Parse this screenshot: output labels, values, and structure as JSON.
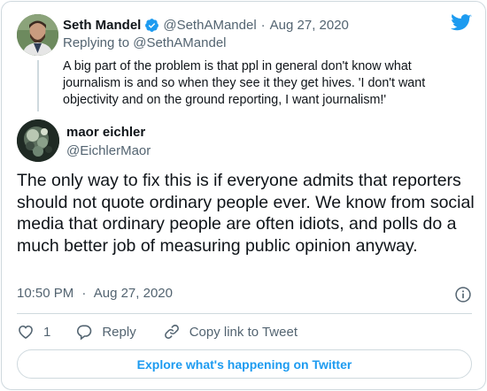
{
  "parent_tweet": {
    "name": "Seth Mandel",
    "handle": "@SethAMandel",
    "separator": "·",
    "date": "Aug 27, 2020",
    "replying_prefix": "Replying to",
    "replying_handle": "@SethAMandel",
    "text": "A big part of the problem is that ppl in general don't know what journalism is and so when they see it they get hives. 'I don't want objectivity and on the ground reporting, I want journalism!'"
  },
  "main_tweet": {
    "name": "maor eichler",
    "handle": "@EichlerMaor",
    "text": "The only way to fix this is if everyone admits that reporters should not quote ordinary people ever. We know from social media that ordinary people are often idiots, and polls do a much better job of measuring public opinion anyway.",
    "time": "10:50 PM",
    "separator": "·",
    "date": "Aug 27, 2020"
  },
  "actions": {
    "like_count": "1",
    "reply_label": "Reply",
    "copy_link_label": "Copy link to Tweet"
  },
  "explore_label": "Explore what's happening on Twitter",
  "icons": {
    "brand": "twitter-bird-icon",
    "verified": "verified-badge-icon",
    "info": "info-icon",
    "like": "heart-icon",
    "reply": "reply-bubble-icon",
    "copy_link": "link-icon"
  },
  "colors": {
    "brand_blue": "#1d9bf0",
    "text": "#0f1419",
    "muted": "#536471",
    "border": "#cfd9de"
  }
}
